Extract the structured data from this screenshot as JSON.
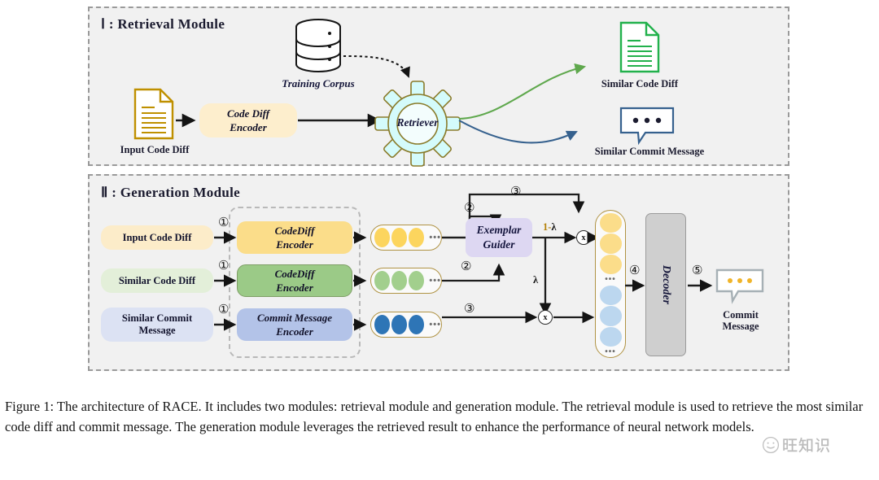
{
  "figure": {
    "caption": "Figure 1: The architecture of RACE. It includes two modules: retrieval module and generation module. The retrieval module is used to retrieve the most similar code diff and commit message. The generation module leverages the retrieved result to enhance the performance of neural network models."
  },
  "retrieval_module": {
    "title": "Ⅰ : Retrieval Module",
    "nodes": {
      "training_corpus": "Training Corpus",
      "input_code_diff": "Input Code Diff",
      "code_diff_encoder_line1": "Code Diff",
      "code_diff_encoder_line2": "Encoder",
      "retriever": "Retriever",
      "similar_code_diff": "Similar Code Diff",
      "similar_commit_message": "Similar Commit Message"
    },
    "colors": {
      "input_doc_icon": "#bf9000",
      "encoder_fill": "#fdeecd",
      "gear_fill": "#d4fbfb",
      "gear_stroke": "#8a7b2a",
      "similar_code_diff_icon": "#22b14c",
      "similar_commit_icon": "#36618e",
      "arrow_green": "#5fa84d",
      "arrow_blue": "#36618e"
    }
  },
  "generation_module": {
    "title": "Ⅱ : Generation Module",
    "inputs": [
      {
        "label": "Input Code Diff",
        "fill": "#fcecc9"
      },
      {
        "label": "Similar Code Diff",
        "fill": "#e3efd9"
      },
      {
        "label": "Similar Commit\nMessage",
        "fill": "#dce2f3"
      }
    ],
    "encoders": [
      {
        "line1": "CodeDiff",
        "line2": "Encoder",
        "fill": "#fbdd8a",
        "bordered": false
      },
      {
        "line1": "CodeDiff",
        "line2": "Encoder",
        "fill": "#9bca87",
        "bordered": true
      },
      {
        "line1": "Commit Message",
        "line2": "Encoder",
        "fill": "#b3c3e8",
        "bordered": false
      }
    ],
    "token_rows": [
      {
        "dot_color": "#fcd55e",
        "dots": 3,
        "ellipsis": "•••"
      },
      {
        "dot_color": "#a2cf8d",
        "dots": 3,
        "ellipsis": "•••"
      },
      {
        "dot_color": "#2e75b6",
        "dots": 3,
        "ellipsis": "•••"
      }
    ],
    "guider": {
      "line1": "Exemplar",
      "line2": "Guider",
      "fill": "#ddd7f2"
    },
    "weights": {
      "one_minus_lambda_prefix": "1-",
      "lambda_symbol": "λ",
      "lambda_only": "λ"
    },
    "multiply_symbol": "x",
    "fusion_stack": {
      "groups": [
        {
          "dot_color": "#fbdd8a",
          "dots": 3,
          "ellipsis": "•••"
        },
        {
          "dot_color": "#bcd7ef",
          "dots": 3,
          "ellipsis": "•••"
        }
      ]
    },
    "decoder": {
      "label": "Decoder",
      "fill": "#cfcfcf"
    },
    "output": {
      "label_line1": "Commit",
      "label_line2": "Message",
      "icon_stroke": "#a6b0b5",
      "dot_color": "#f0b429"
    },
    "steps": [
      "①",
      "①",
      "①",
      "②",
      "②",
      "③",
      "③",
      "④",
      "⑤"
    ]
  },
  "watermark": {
    "text": "旺知识",
    "icon": "smiley-face-icon"
  }
}
